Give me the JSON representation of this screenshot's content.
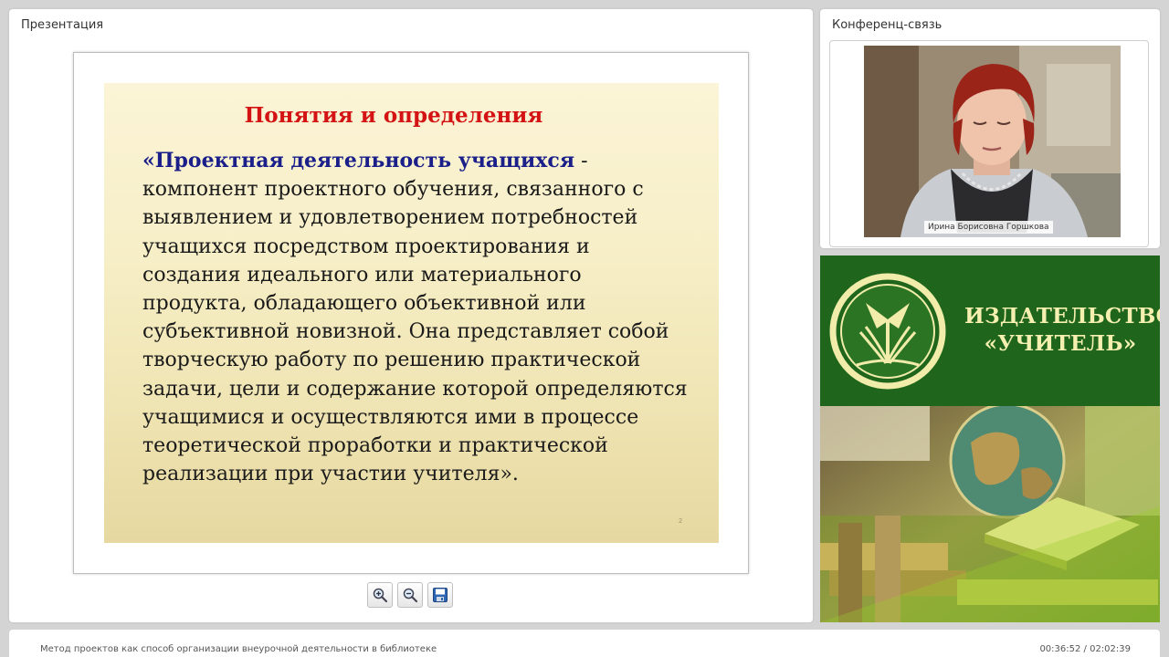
{
  "presentation": {
    "title": "Презентация",
    "slide": {
      "heading": "Понятия и определения",
      "term": "«Проектная деятельность учащихся",
      "definition": " - компонент проектного обучения, связанного с выявлением и удовлетворением потребностей учащихся посредством проектирования и создания идеального или материального продукта, обладающего объективной или субъективной новизной. Она представляет собой творческую работу по решению практической задачи, цели и содержание которой определяются учащимися и осуществляются ими в процессе теоретической проработки и практической реализации при участии учителя».",
      "page_number": "2"
    },
    "toolbar": {
      "zoom_in_icon": "zoom-in-icon",
      "zoom_out_icon": "zoom-out-icon",
      "save_icon": "floppy-disk-icon"
    }
  },
  "conference": {
    "title": "Конференц-связь",
    "speaker_name": "Ирина Борисовна Горшкова"
  },
  "ad": {
    "line1": "ИЗДАТЕЛЬСТВО",
    "line2": "«УЧИТЕЛЬ»",
    "colors": {
      "green": "#1f661c",
      "text": "#f5efb0"
    }
  },
  "footer": {
    "title": "Метод проектов как способ организации внеурочной деятельности в библиотеке",
    "time": "00:36:52 / 02:02:39"
  }
}
